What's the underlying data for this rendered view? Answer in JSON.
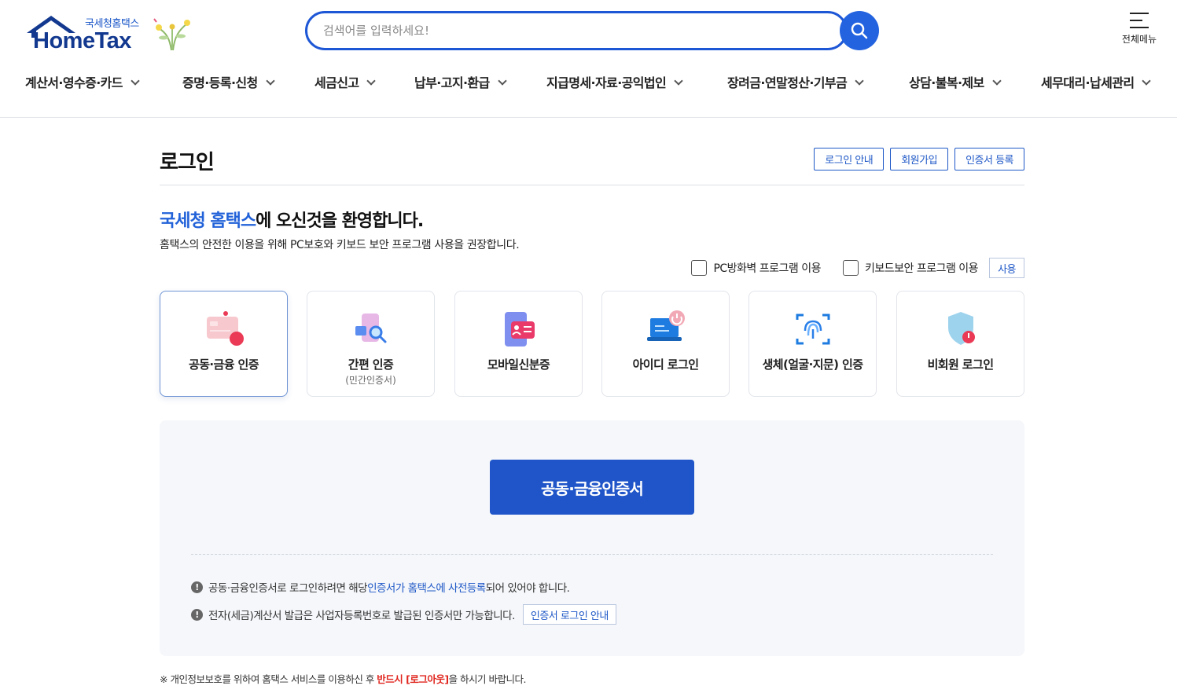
{
  "header": {
    "logo_sub": "국세청홈택스",
    "logo_main": "HomeTax",
    "search_placeholder": "검색어를 입력하세요!",
    "all_menu_label": "전체메뉴",
    "nav": [
      {
        "label": "계산서·영수증·카드"
      },
      {
        "label": "증명·등록·신청"
      },
      {
        "label": "세금신고"
      },
      {
        "label": "납부·고지·환급"
      },
      {
        "label": "지급명세·자료·공익법인"
      },
      {
        "label": "장려금·연말정산·기부금"
      },
      {
        "label": "상담·불복·제보"
      },
      {
        "label": "세무대리·납세관리"
      }
    ]
  },
  "page": {
    "title": "로그인",
    "top_buttons": [
      "로그인 안내",
      "회원가입",
      "인증서 등록"
    ],
    "welcome_highlight": "국세청 홈택스",
    "welcome_rest": "에 오신것을 환영합니다.",
    "recommend": "홈택스의 안전한 이용을 위해 PC보호와 키보드 보안 프로그램 사용을 권장합니다.",
    "options": {
      "pc_firewall": "PC방화벽 프로그램 이용",
      "keyboard_security": "키보드보안 프로그램 이용",
      "use_button": "사용"
    }
  },
  "methods": [
    {
      "label": "공동·금융 인증",
      "sub": "",
      "icon": "certificate-icon",
      "active": true
    },
    {
      "label": "간편 인증",
      "sub": "(민간인증서)",
      "icon": "simple-auth-icon",
      "active": false
    },
    {
      "label": "모바일신분증",
      "sub": "",
      "icon": "mobile-id-icon",
      "active": false
    },
    {
      "label": "아이디 로그인",
      "sub": "",
      "icon": "laptop-icon",
      "active": false
    },
    {
      "label": "생체(얼굴·지문) 인증",
      "sub": "",
      "icon": "fingerprint-icon",
      "active": false
    },
    {
      "label": "비회원 로그인",
      "sub": "",
      "icon": "shield-icon",
      "active": false
    }
  ],
  "panel": {
    "main_button": "공동·금융인증서",
    "note1_pre": "공동·금융인증서로 로그인하려면 해당 ",
    "note1_link": "인증서가 홈택스에 사전등록",
    "note1_post": "되어 있어야 합니다.",
    "note2": "전자(세금)계산서 발급은 사업자등록번호로 발급된 인증서만 가능합니다.",
    "note2_button": "인증서 로그인 안내"
  },
  "footnote": {
    "pre": "※ 개인정보보호를 위하여 홈택스 서비스를 이용하신 후 ",
    "red": "반드시 [로그아웃]",
    "post": "을 하시기 바랍니다."
  },
  "colors": {
    "accent": "#1f55c8",
    "highlight": "#2262d9",
    "warning_red": "#e0261f",
    "panel_bg": "#f5f7fa"
  }
}
